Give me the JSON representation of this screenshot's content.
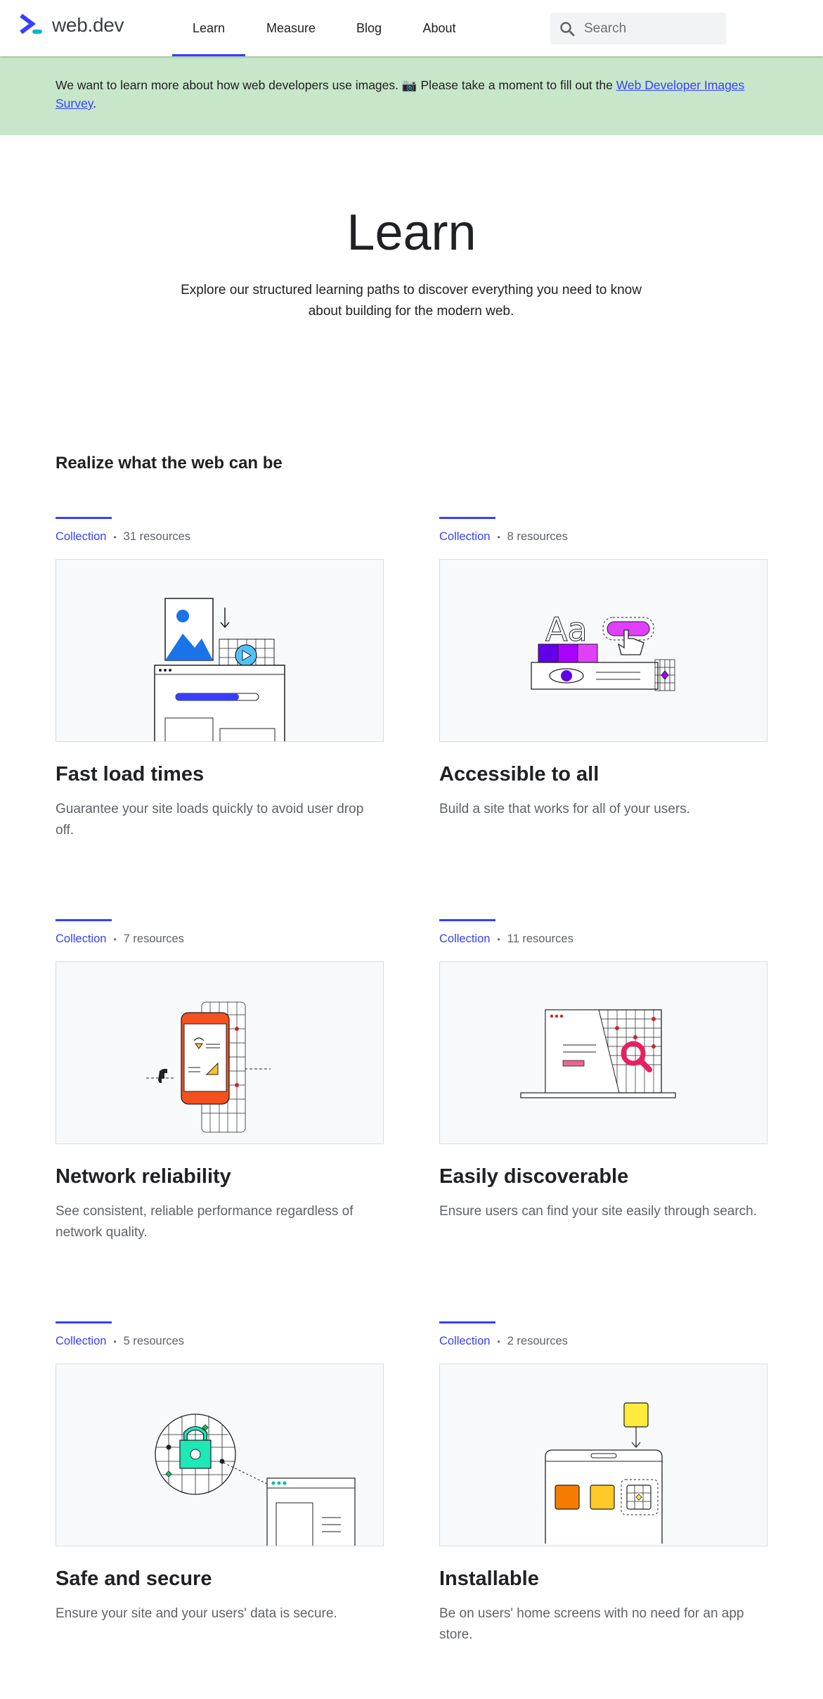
{
  "header": {
    "logo_text": "web.dev",
    "nav": [
      {
        "label": "Learn",
        "active": true
      },
      {
        "label": "Measure",
        "active": false
      },
      {
        "label": "Blog",
        "active": false
      },
      {
        "label": "About",
        "active": false
      }
    ],
    "search_placeholder": "Search"
  },
  "banner": {
    "text": "We want to learn more about how web developers use images. 📷 Please take a moment to fill out the ",
    "link_text": "Web Developer Images Survey",
    "suffix": "."
  },
  "hero": {
    "title": "Learn",
    "description": "Explore our structured learning paths to discover everything you need to know about building for the modern web."
  },
  "section": {
    "title": "Realize what the web can be"
  },
  "cards": [
    {
      "type": "Collection",
      "resources": "31 resources",
      "title": "Fast load times",
      "description": "Guarantee your site loads quickly to avoid user drop off."
    },
    {
      "type": "Collection",
      "resources": "8 resources",
      "title": "Accessible to all",
      "description": "Build a site that works for all of your users."
    },
    {
      "type": "Collection",
      "resources": "7 resources",
      "title": "Network reliability",
      "description": "See consistent, reliable performance regardless of network quality."
    },
    {
      "type": "Collection",
      "resources": "11 resources",
      "title": "Easily discoverable",
      "description": "Ensure users can find your site easily through search."
    },
    {
      "type": "Collection",
      "resources": "5 resources",
      "title": "Safe and secure",
      "description": "Ensure your site and your users' data is secure."
    },
    {
      "type": "Collection",
      "resources": "2 resources",
      "title": "Installable",
      "description": "Be on users' home screens with no need for an app store."
    }
  ],
  "colors": {
    "accent": "#3740ff",
    "banner_bg": "#c8e6c9",
    "card_bg": "#f8f9fa"
  }
}
